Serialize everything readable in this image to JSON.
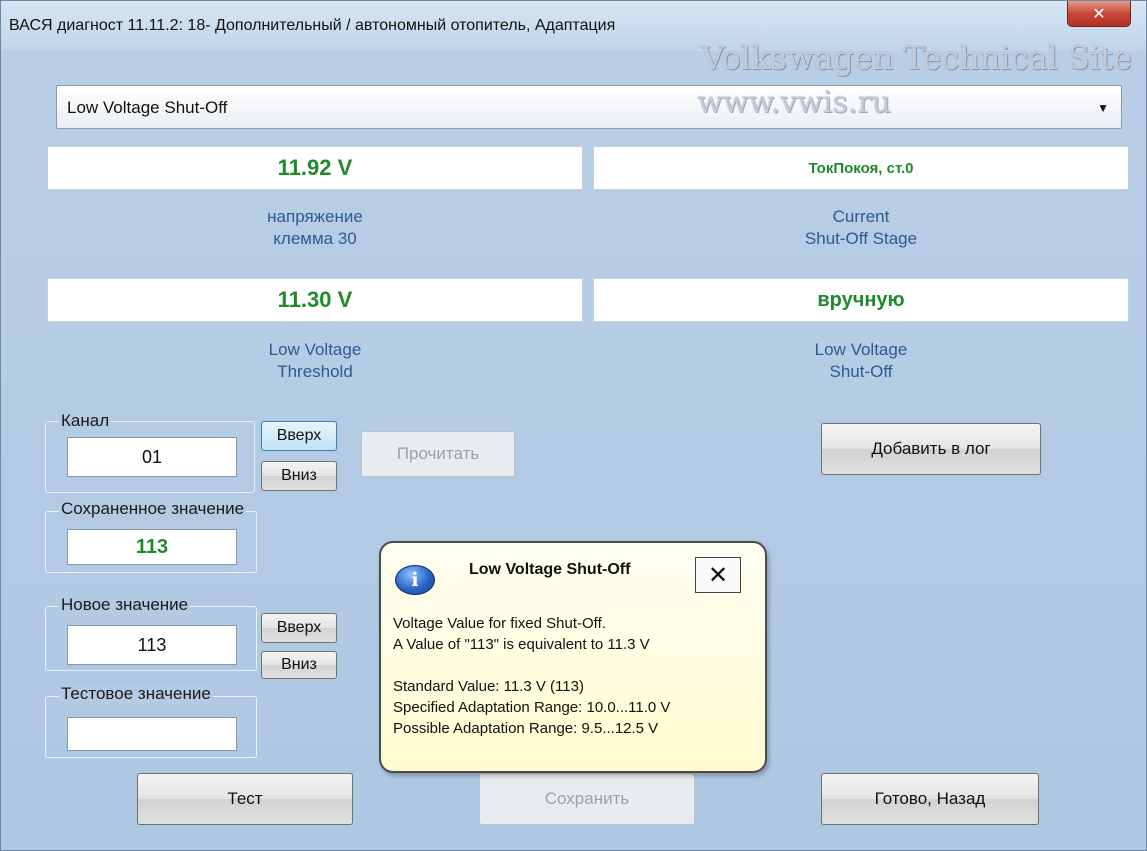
{
  "window": {
    "title": "ВАСЯ диагност 11.11.2: 18- Дополнительный / автономный отопитель, Адаптация",
    "close_glyph": "✕"
  },
  "watermark": {
    "line1": "Volkswagen Technical Site",
    "line2": "www.vwis.ru"
  },
  "channel_select": {
    "value": "Low Voltage Shut-Off",
    "arrow_icon": "chevron-down-icon"
  },
  "measures": [
    {
      "value": "11.92 V",
      "label_line1": "напряжение",
      "label_line2": "клемма 30"
    },
    {
      "value": "ТокПокоя, ст.0",
      "label_line1": "Current",
      "label_line2": "Shut-Off Stage"
    },
    {
      "value": "11.30 V",
      "label_line1": "Low Voltage",
      "label_line2": "Threshold"
    },
    {
      "value": "вручную",
      "label_line1": "Low Voltage",
      "label_line2": "Shut-Off"
    }
  ],
  "channel": {
    "label": "Канал",
    "value": "01",
    "up_label": "Вверх",
    "down_label": "Вниз",
    "read_label": "Прочитать"
  },
  "add_log_label": "Добавить в лог",
  "saved_value": {
    "label": "Сохраненное значение",
    "value": "113"
  },
  "new_value": {
    "label": "Новое значение",
    "value": "113",
    "up_label": "Вверх",
    "down_label": "Вниз"
  },
  "test_value": {
    "label": "Тестовое значение",
    "value": ""
  },
  "buttons": {
    "test": "Тест",
    "save": "Сохранить",
    "done": "Готово, Назад"
  },
  "tooltip": {
    "icon": "info-icon",
    "icon_glyph": "i",
    "title": "Low Voltage Shut-Off",
    "close_glyph": "✕",
    "line1": "Voltage Value for fixed Shut-Off.",
    "line2": "A Value of \"113\" is equivalent to 11.3 V",
    "line3": "Standard Value: 11.3 V (113)",
    "line4": "Specified Adaptation Range: 10.0...11.0 V",
    "line5": "Possible Adaptation Range: 9.5...12.5 V"
  },
  "colors": {
    "value_green": "#1f8a2a",
    "caption_blue": "#2e5a92"
  }
}
